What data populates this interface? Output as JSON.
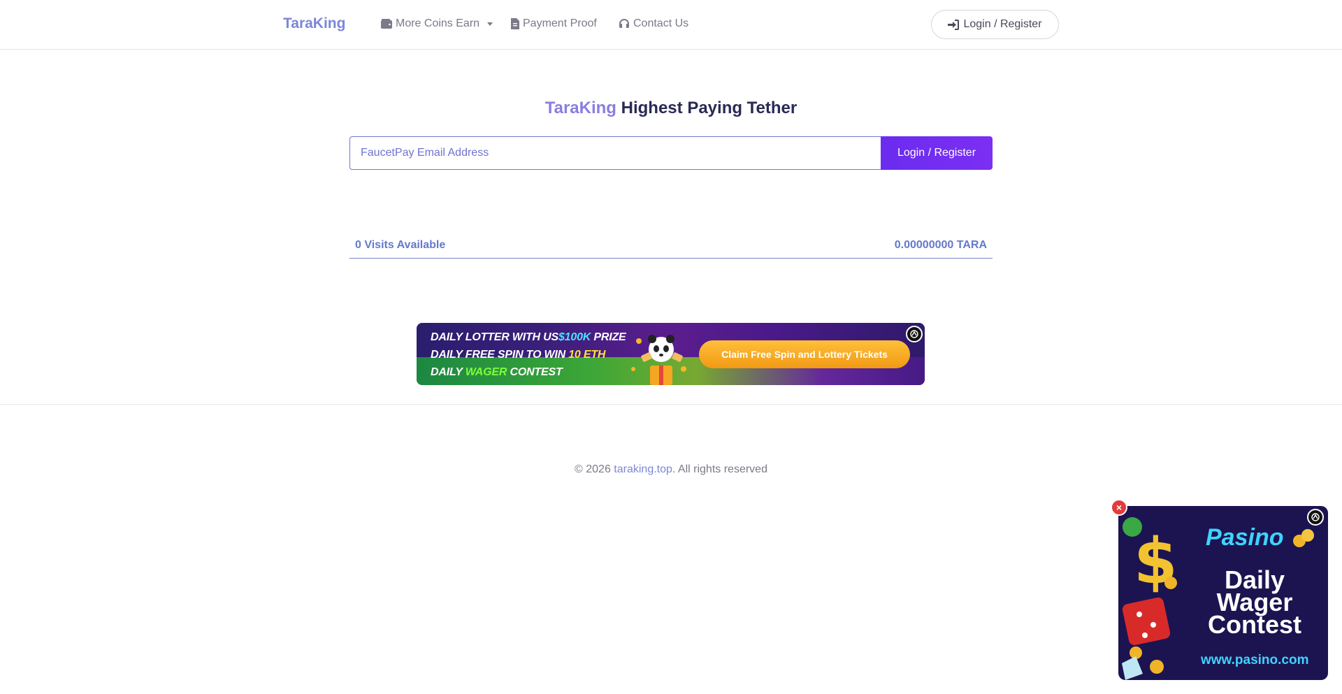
{
  "nav": {
    "brand": "TaraKing",
    "items": [
      {
        "label": "More Coins Earn"
      },
      {
        "label": "Payment Proof"
      },
      {
        "label": "Contact Us"
      }
    ],
    "login_label": "Login / Register"
  },
  "hero": {
    "title_accent": "TaraKing",
    "title_rest": "Highest Paying Tether",
    "email_placeholder": "FaucetPay Email Address",
    "submit_label": "Login / Register"
  },
  "stats": {
    "visits": "0 Visits Available",
    "balance": "0.00000000 TARA"
  },
  "banner_ad": {
    "line1_a": "DAILY LOTTER WITH US",
    "line1_b": "$100K",
    "line1_c": " PRIZE",
    "line2_a": "DAILY FREE SPIN TO WIN ",
    "line2_b": "10 ETH",
    "line3_a": "DAILY ",
    "line3_b": "WAGER",
    "line3_c": " CONTEST",
    "cta": "Claim Free Spin and Lottery Tickets"
  },
  "footer": {
    "prefix": "© 2026 ",
    "link": "taraking.top",
    "suffix": ". All rights reserved"
  },
  "side_ad": {
    "logo": "Pasino",
    "title_lines": [
      "Daily",
      "Wager",
      "Contest"
    ],
    "url": "www.pasino.com",
    "close": "×"
  },
  "colors": {
    "brand": "#7c86d8",
    "accent": "#8a7ee0",
    "button": "#6a2cf0",
    "stats_text": "#6479cc"
  }
}
